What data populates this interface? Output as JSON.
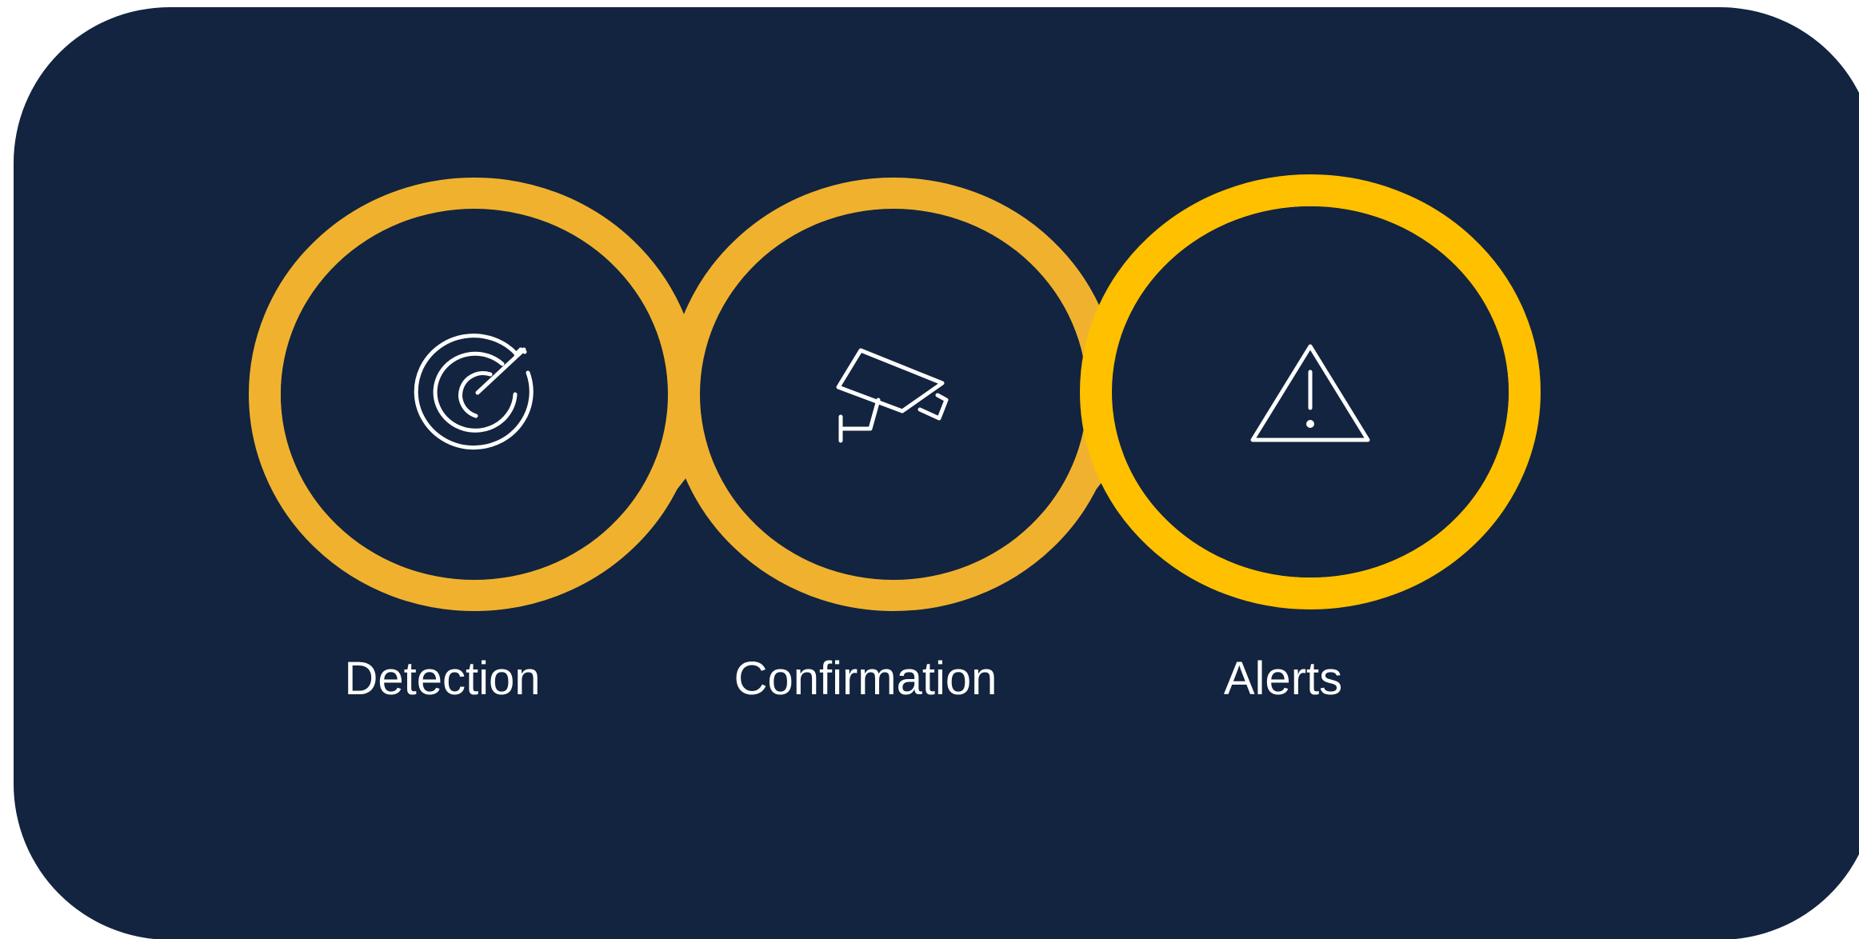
{
  "colors": {
    "panel": "#12243F",
    "ring": "#F0B22E",
    "ring_highlight": "#FFC000",
    "icon": "#FFFFFF",
    "label": "#FFFFFF"
  },
  "steps": [
    {
      "label": "Detection",
      "icon": "radar-icon"
    },
    {
      "label": "Confirmation",
      "icon": "security-camera-icon"
    },
    {
      "label": "Alerts",
      "icon": "warning-triangle-icon"
    }
  ]
}
